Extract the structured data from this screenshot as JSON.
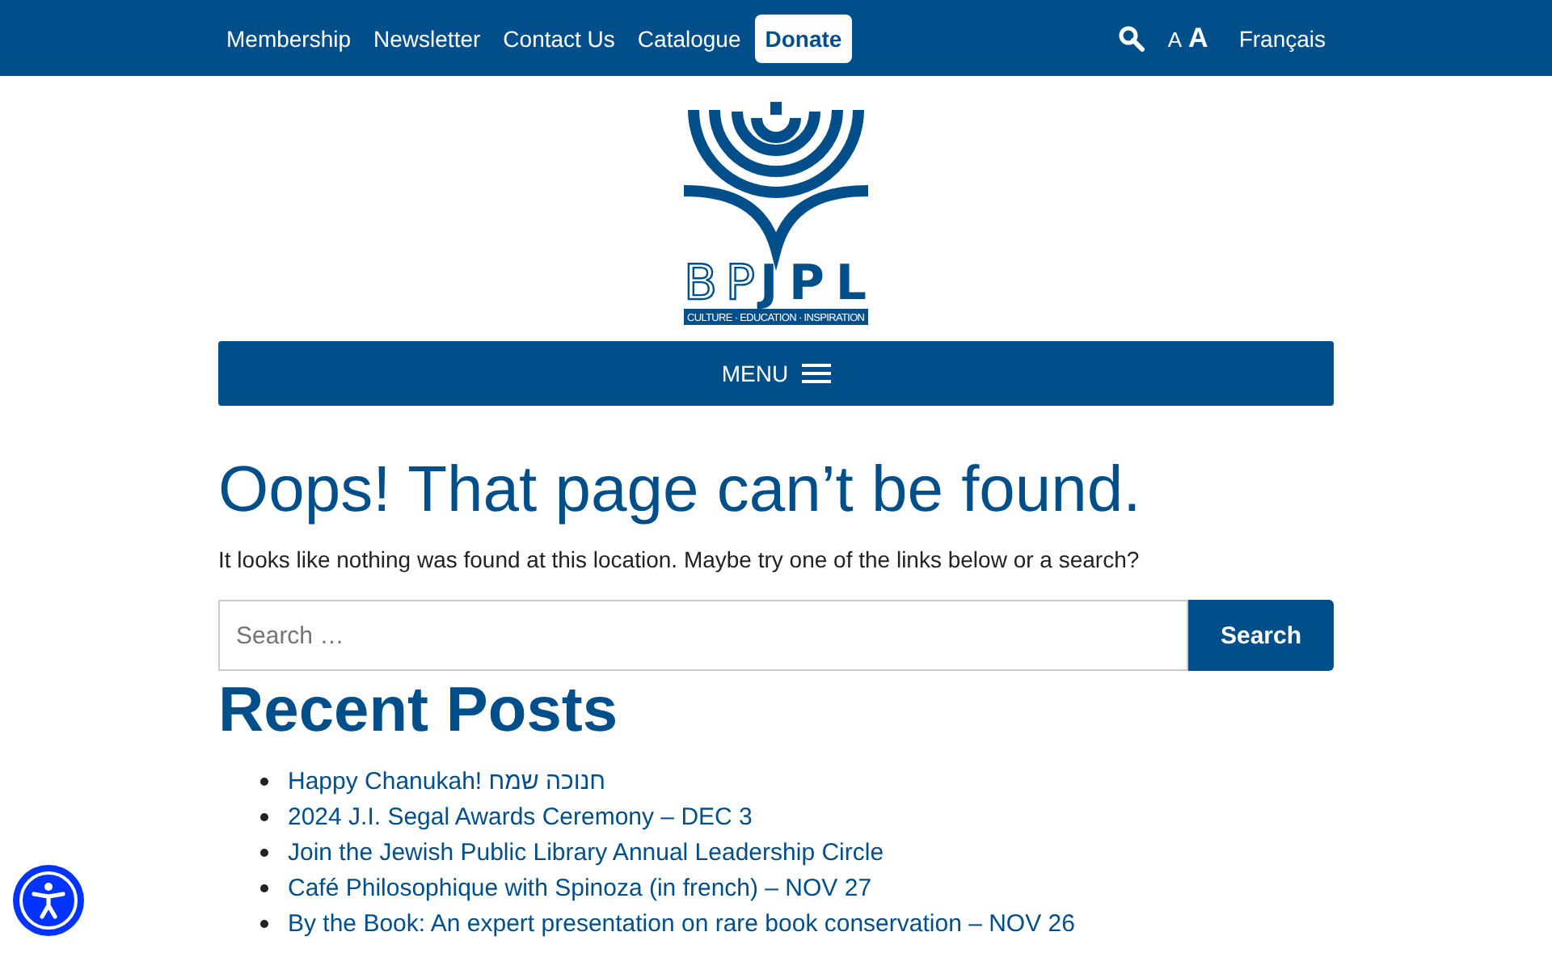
{
  "top_bar": {
    "links": [
      {
        "label": "Membership",
        "kind": "link"
      },
      {
        "label": "Newsletter",
        "kind": "link"
      },
      {
        "label": "Contact Us",
        "kind": "link"
      },
      {
        "label": "Catalogue",
        "kind": "link"
      },
      {
        "label": "Donate",
        "kind": "button"
      }
    ],
    "font_small": "A",
    "font_large": "A",
    "language": "Français"
  },
  "logo": {
    "letters_outline": "BP",
    "letters_solid": "JPL",
    "tagline": "CULTURE · EDUCATION · INSPIRATION"
  },
  "menu": {
    "label": "MENU"
  },
  "heading": "Oops! That page can’t be found.",
  "message": "It looks like nothing was found at this location. Maybe try one of the links below or a search?",
  "search": {
    "placeholder": "Search …",
    "button": "Search"
  },
  "recent_posts": {
    "title": "Recent Posts",
    "items": [
      "Happy Chanukah! חנוכה שמח",
      "2024 J.I. Segal Awards Ceremony – DEC 3",
      "Join the Jewish Public Library Annual Leadership Circle",
      "Café Philosophique with Spinoza (in french) – NOV 27",
      "By the Book: An expert presentation on rare book conservation – NOV 26"
    ]
  }
}
